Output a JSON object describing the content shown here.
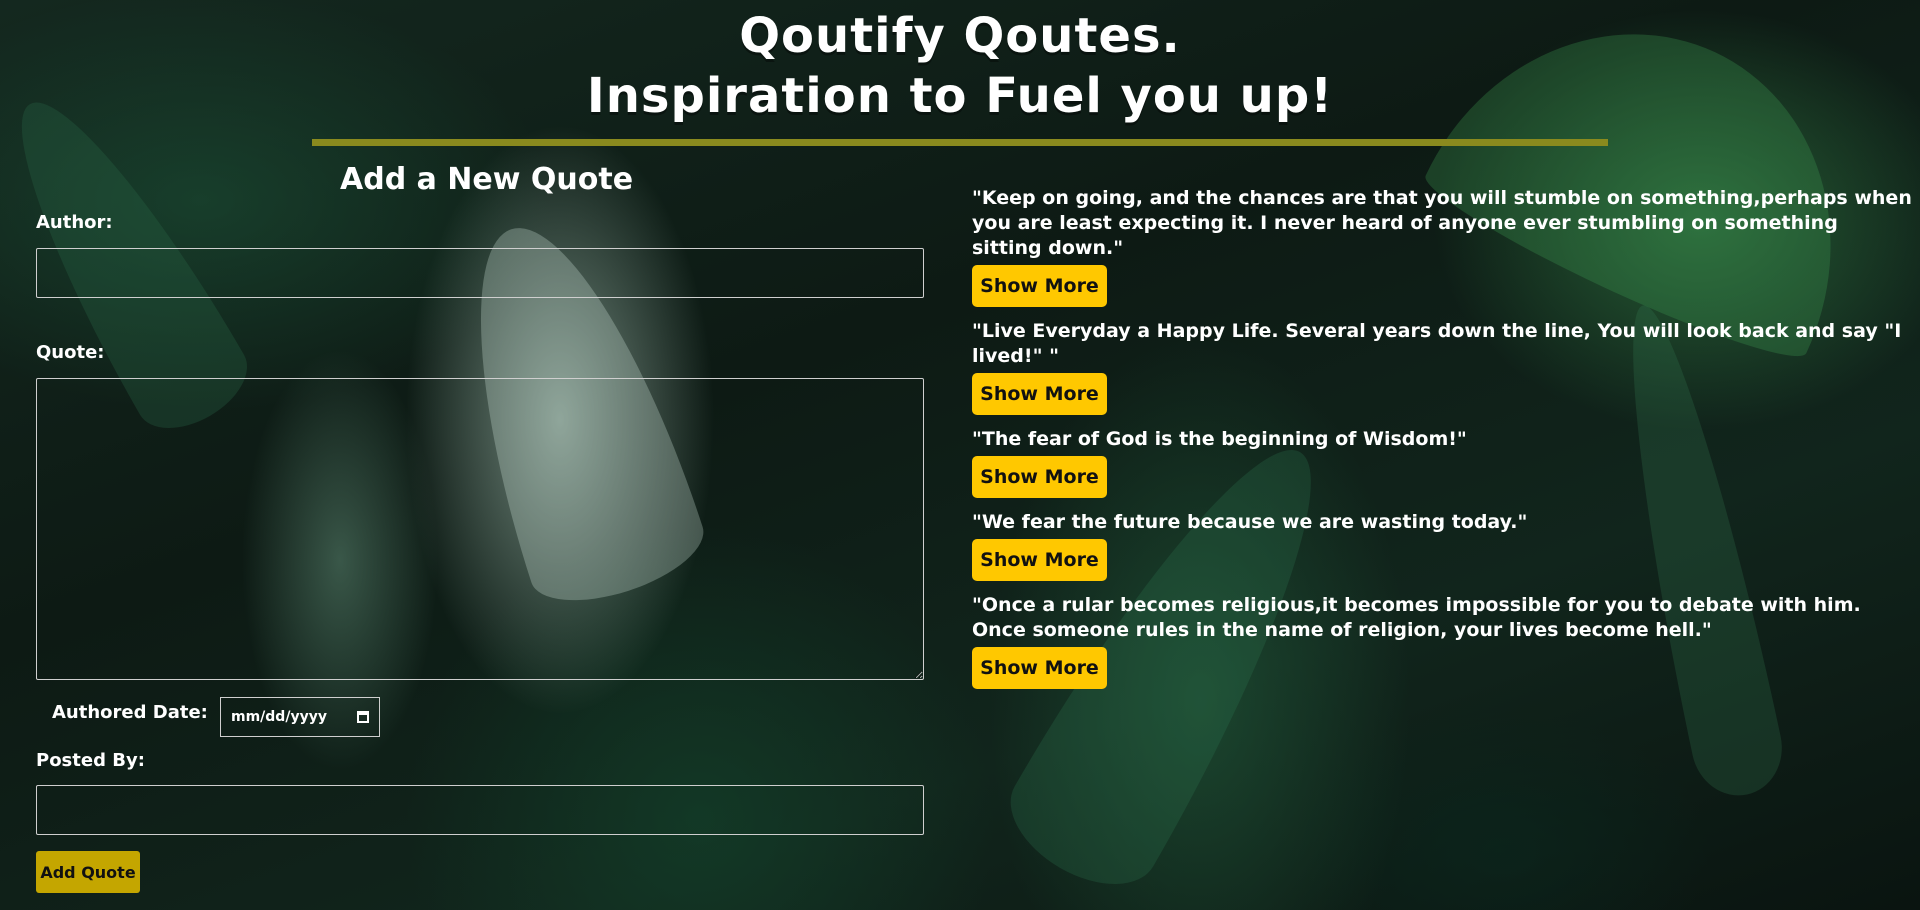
{
  "header": {
    "title_line1": "Qoutify Qoutes.",
    "title_line2": "Inspiration to Fuel you up!"
  },
  "colors": {
    "accent_yellow": "#ffc800",
    "add_button": "#c4a600",
    "divider": "#8a8a1e"
  },
  "form": {
    "title": "Add a New Quote",
    "author_label": "Author:",
    "author_value": "",
    "quote_label": "Quote:",
    "quote_value": "",
    "date_label": "Authored Date:",
    "date_placeholder": "mm/dd/yyyy",
    "posted_by_label": "Posted By:",
    "posted_by_value": "",
    "submit_label": "Add Quote"
  },
  "quotes": [
    {
      "text": "\"Keep on going, and the chances are that you will stumble on something,perhaps when you are least expecting it. I never heard of anyone ever stumbling on something sitting down.\"",
      "button": "Show More"
    },
    {
      "text": "\"Live Everyday a Happy Life. Several years down the line, You will look back and say \"I lived!\" \"",
      "button": "Show More"
    },
    {
      "text": "\"The fear of God is the beginning of Wisdom!\"",
      "button": "Show More"
    },
    {
      "text": "\"We fear the future because we are wasting today.\"",
      "button": "Show More"
    },
    {
      "text": "\"Once a rular becomes religious,it becomes impossible for you to debate with him. Once someone rules in the name of religion, your lives become hell.\"",
      "button": "Show More"
    }
  ]
}
